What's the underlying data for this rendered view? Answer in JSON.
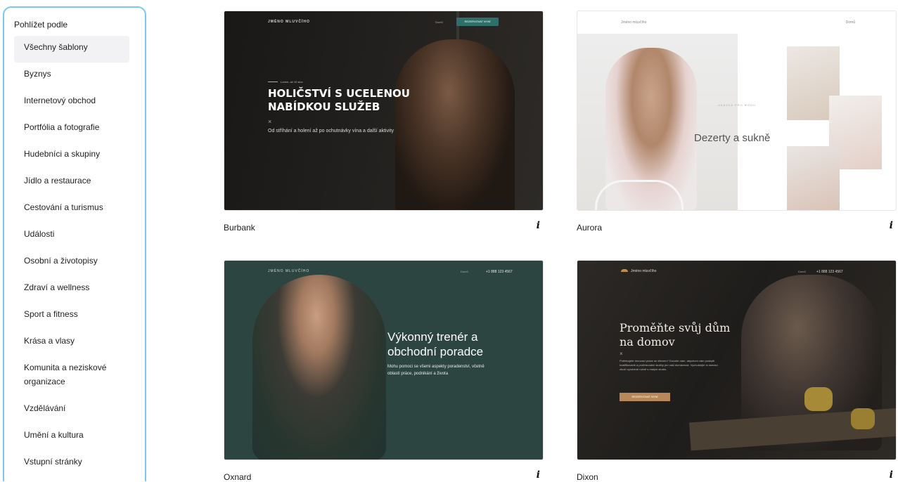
{
  "sidebar": {
    "heading": "Pohlížet podle",
    "items": [
      {
        "label": "Všechny šablony"
      },
      {
        "label": "Byznys"
      },
      {
        "label": "Internetový obchod"
      },
      {
        "label": "Portfólia a fotografie"
      },
      {
        "label": "Hudebníci a skupiny"
      },
      {
        "label": "Jídlo a restaurace"
      },
      {
        "label": "Cestování a turismus"
      },
      {
        "label": "Události"
      },
      {
        "label": "Osobní a životopisy"
      },
      {
        "label": "Zdraví a wellness"
      },
      {
        "label": "Sport a fitness"
      },
      {
        "label": "Krása a vlasy"
      },
      {
        "label": "Komunita a neziskové organizace"
      },
      {
        "label": "Vzdělávání"
      },
      {
        "label": "Umění a kultura"
      },
      {
        "label": "Vstupní stránky"
      }
    ],
    "active_index": 0
  },
  "info_icon_glyph": "i",
  "templates": [
    {
      "name": "Burbank",
      "preview": {
        "brand": "JMÉNO MLUVČÍHO",
        "nav_link": "Domů",
        "nav_button": "REZERVOVAT NYNÍ",
        "kicker": "Lorem, až 10 slov",
        "heading": "HOLIČSTVÍ S UCELENOU NABÍDKOU SLUŽEB",
        "mark": "×",
        "sub": "Od stříhání a holení až po ochutnávky vína a další aktivity"
      }
    },
    {
      "name": "Aurora",
      "preview": {
        "logo": "Jméno mluvčího",
        "nav": "Domů",
        "kicker": "UKÁZKA PRO MÓDU",
        "title": "Dezerty a sukně"
      }
    },
    {
      "name": "Oxnard",
      "preview": {
        "brand": "JMÉNO MLUVČÍHO",
        "nav_link": "Domů",
        "phone": "+1 888 123 4567",
        "title": "Výkonný trenér a obchodní poradce",
        "sub": "Mohu pomoci se všemi aspekty poradenství, včetně oblastí práce, podnikání a života"
      }
    },
    {
      "name": "Dixon",
      "preview": {
        "brand": "Jméno mluvčího",
        "nav_link": "Domů",
        "phone": "+1 888 123 4567",
        "title": "Proměňte svůj dům na domov",
        "mark": "×",
        "sub": "Potřebujete renovaci práce se dřevem? Dovolte nám, abychom vám poskytli kvalifikované a profesionální služby pro vaši domácnost. Vychutnejte si domácí zboží vyrobené ručně s malým studiu.",
        "button": "REZERVOVAT NYNÍ"
      }
    }
  ]
}
